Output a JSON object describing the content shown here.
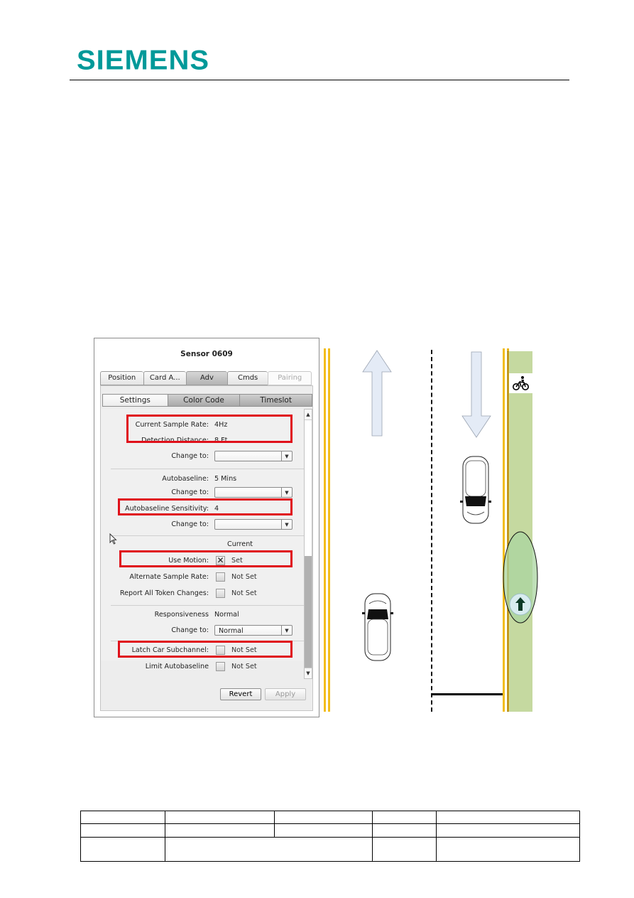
{
  "header": {
    "logo_text": "SIEMENS",
    "brand_color": "#009999"
  },
  "dialog": {
    "title": "Sensor 0609",
    "tabs": [
      {
        "label": "Position",
        "state": "normal"
      },
      {
        "label": "Card A...",
        "state": "normal"
      },
      {
        "label": "Adv",
        "state": "active"
      },
      {
        "label": "Cmds",
        "state": "normal"
      },
      {
        "label": "Pairing",
        "state": "disabled"
      }
    ],
    "subtabs": [
      {
        "label": "Settings",
        "state": "active"
      },
      {
        "label": "Color Code",
        "state": "normal"
      },
      {
        "label": "Timeslot",
        "state": "normal"
      }
    ],
    "fields": {
      "current_sample_rate": {
        "label": "Current Sample Rate:",
        "value": "4Hz"
      },
      "detection_distance": {
        "label": "Detection Distance:",
        "value": "8 Ft"
      },
      "change_to_1": {
        "label": "Change to:",
        "value": ""
      },
      "autobaseline": {
        "label": "Autobaseline:",
        "value": "5 Mins"
      },
      "change_to_2": {
        "label": "Change to:",
        "value": ""
      },
      "autobaseline_sensitivity": {
        "label": "Autobaseline Sensitivity:",
        "value": "4"
      },
      "change_to_3": {
        "label": "Change to:",
        "value": ""
      },
      "current_header": "Current",
      "use_motion": {
        "label": "Use Motion:",
        "checked": true,
        "status": "Set"
      },
      "alternate_sample_rate": {
        "label": "Alternate Sample Rate:",
        "checked": false,
        "status": "Not Set"
      },
      "report_all_token_changes": {
        "label": "Report All Token Changes:",
        "checked": false,
        "status": "Not Set"
      },
      "responsiveness": {
        "label": "Responsiveness",
        "value": "Normal"
      },
      "change_to_4": {
        "label": "Change to:",
        "value": "Normal"
      },
      "latch_car_subchannel": {
        "label": "Latch Car Subchannel:",
        "checked": false,
        "status": "Not Set"
      },
      "limit_autobaseline": {
        "label": "Limit Autobaseline",
        "checked": false,
        "status": "Not Set"
      }
    },
    "check_mark": "✕",
    "scroll_up": "▲",
    "scroll_down": "▼",
    "dropdown_arrow": "▼",
    "buttons": {
      "revert": "Revert",
      "apply": "Apply"
    },
    "highlight_color": "#e0101a"
  },
  "diagram": {
    "lane_line_color": "#f2bd1b",
    "bike_lane_color": "#c5d9a0",
    "bike_symbol": "bicycle-icon"
  },
  "footer_table": {
    "rows": [
      [
        "",
        "",
        "",
        "",
        ""
      ],
      [
        "",
        "",
        "",
        "",
        ""
      ],
      [
        "",
        "",
        "",
        ""
      ]
    ]
  }
}
